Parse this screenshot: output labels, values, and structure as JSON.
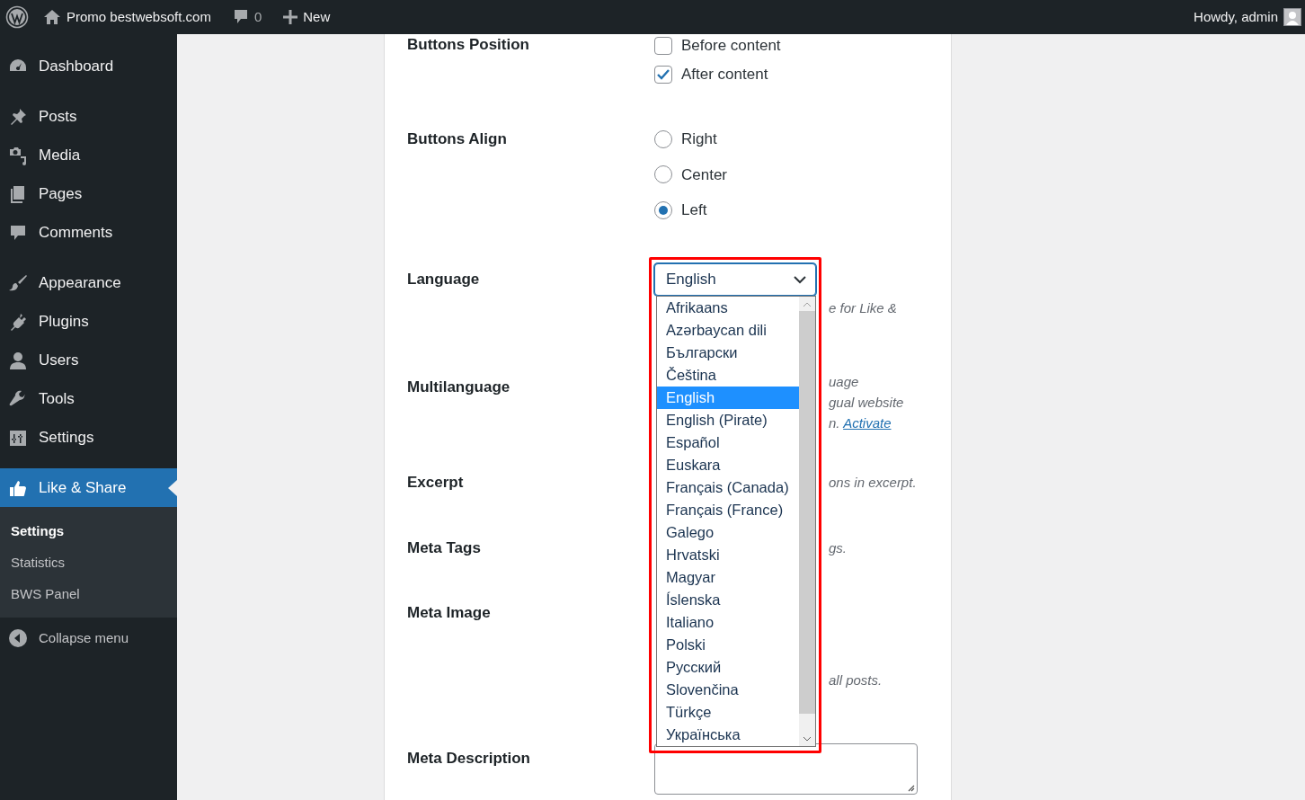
{
  "admin_bar": {
    "site": "Promo bestwebsoft.com",
    "comments": "0",
    "new": "New",
    "greeting": "Howdy, admin"
  },
  "sidebar": {
    "groups": [
      {
        "items": [
          {
            "label": "Dashboard",
            "selected": false
          }
        ]
      },
      {
        "items": [
          {
            "label": "Posts",
            "selected": false
          },
          {
            "label": "Media",
            "selected": false
          },
          {
            "label": "Pages",
            "selected": false
          },
          {
            "label": "Comments",
            "selected": false
          }
        ]
      },
      {
        "items": [
          {
            "label": "Appearance",
            "selected": false
          },
          {
            "label": "Plugins",
            "selected": false
          },
          {
            "label": "Users",
            "selected": false
          },
          {
            "label": "Tools",
            "selected": false
          },
          {
            "label": "Settings",
            "selected": false
          }
        ]
      },
      {
        "items": [
          {
            "label": "Like & Share",
            "selected": true,
            "children": [
              {
                "label": "Settings",
                "selected": true
              },
              {
                "label": "Statistics",
                "selected": false
              },
              {
                "label": "BWS Panel",
                "selected": false
              }
            ]
          }
        ]
      }
    ],
    "collapse": "Collapse menu"
  },
  "form": {
    "rows": [
      {
        "kind": "checkboxes",
        "label": "Buttons Position",
        "options": [
          {
            "label": "Before content",
            "checked": false
          },
          {
            "label": "After content",
            "checked": true
          }
        ]
      },
      {
        "kind": "radios",
        "label": "Buttons Align",
        "options": [
          {
            "label": "Right",
            "selected": false
          },
          {
            "label": "Center",
            "selected": false
          },
          {
            "label": "Left",
            "selected": true
          }
        ]
      },
      {
        "kind": "select",
        "label": "Language",
        "value": "English",
        "expanded": true,
        "options": [
          {
            "label": "Afrikaans",
            "selected": false
          },
          {
            "label": "Azərbaycan dili",
            "selected": false
          },
          {
            "label": "Български",
            "selected": false
          },
          {
            "label": "Čeština",
            "selected": false
          },
          {
            "label": "English",
            "selected": true
          },
          {
            "label": "English (Pirate)",
            "selected": false
          },
          {
            "label": "Español",
            "selected": false
          },
          {
            "label": "Euskara",
            "selected": false
          },
          {
            "label": "Français (Canada)",
            "selected": false
          },
          {
            "label": "Français (France)",
            "selected": false
          },
          {
            "label": "Galego",
            "selected": false
          },
          {
            "label": "Hrvatski",
            "selected": false
          },
          {
            "label": "Magyar",
            "selected": false
          },
          {
            "label": "Íslenska",
            "selected": false
          },
          {
            "label": "Italiano",
            "selected": false
          },
          {
            "label": "Polski",
            "selected": false
          },
          {
            "label": "Русский",
            "selected": false
          },
          {
            "label": "Slovenčina",
            "selected": false
          },
          {
            "label": "Türkçe",
            "selected": false
          },
          {
            "label": "Українська",
            "selected": false
          }
        ],
        "note": [
          {
            "text": "e for Like &"
          }
        ]
      },
      {
        "kind": "note",
        "label": "Multilanguage",
        "note": [
          {
            "text": "uage"
          },
          {
            "text": "gual website"
          },
          {
            "text": "n.",
            "link": "Activate"
          }
        ]
      },
      {
        "kind": "note",
        "label": "Excerpt",
        "note": [
          {
            "text": "ons in excerpt."
          }
        ]
      },
      {
        "kind": "note",
        "label": "Meta Tags",
        "note": [
          {
            "text": "gs."
          }
        ]
      },
      {
        "kind": "note",
        "label": "Meta Image",
        "note": [
          {
            "text": "all posts."
          }
        ]
      },
      {
        "kind": "textarea",
        "label": "Meta Description"
      }
    ]
  }
}
